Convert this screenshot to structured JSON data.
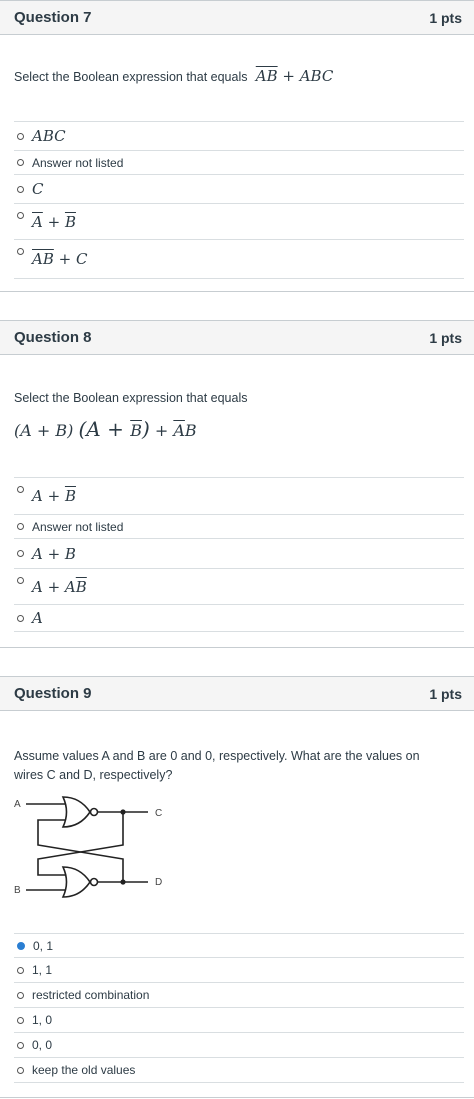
{
  "q7": {
    "title": "Question 7",
    "pts": "1 pts",
    "prompt": "Select the Boolean expression that equals",
    "expr_ov": "AB",
    "expr_rest": " + ABC",
    "answers": [
      {
        "pre": "",
        "ov": "",
        "post": "ABC",
        "math": true
      },
      {
        "text": "Answer not listed"
      },
      {
        "pre": "",
        "ov": "",
        "post": "C",
        "math": true
      },
      {
        "pre": "",
        "ov": "A",
        "mid": " + ",
        "ov2": "B",
        "math": true
      },
      {
        "pre": "",
        "ov": "AB",
        "post": " + C",
        "math": true
      }
    ]
  },
  "q8": {
    "title": "Question 8",
    "pts": "1 pts",
    "prompt": "Select the Boolean expression that equals",
    "expr_a": "(A + B)",
    "expr_b": "(A + ",
    "expr_b_ov": "B",
    "expr_b_end": ")",
    "expr_c": " + ",
    "expr_c_ov": "A",
    "expr_c_end": "B",
    "answers": [
      {
        "pre": "A + ",
        "ov": "B"
      },
      {
        "text": "Answer not listed"
      },
      {
        "pre": "A + B",
        "ov": ""
      },
      {
        "pre": "A + A",
        "ov": "B"
      },
      {
        "pre": "A",
        "ov": ""
      }
    ]
  },
  "q9": {
    "title": "Question 9",
    "pts": "1 pts",
    "prompt_line1": "Assume values A and B are 0 and 0, respectively. What are the values on",
    "prompt_line2": "wires C and D, respectively?",
    "labels": {
      "a": "A",
      "b": "B",
      "c": "C",
      "d": "D"
    },
    "answers": [
      "0, 1",
      "1, 1",
      "restricted combination",
      "1, 0",
      "0, 0",
      "keep the old values"
    ],
    "selected_index": 0,
    "accent": "#2a7ed2"
  }
}
